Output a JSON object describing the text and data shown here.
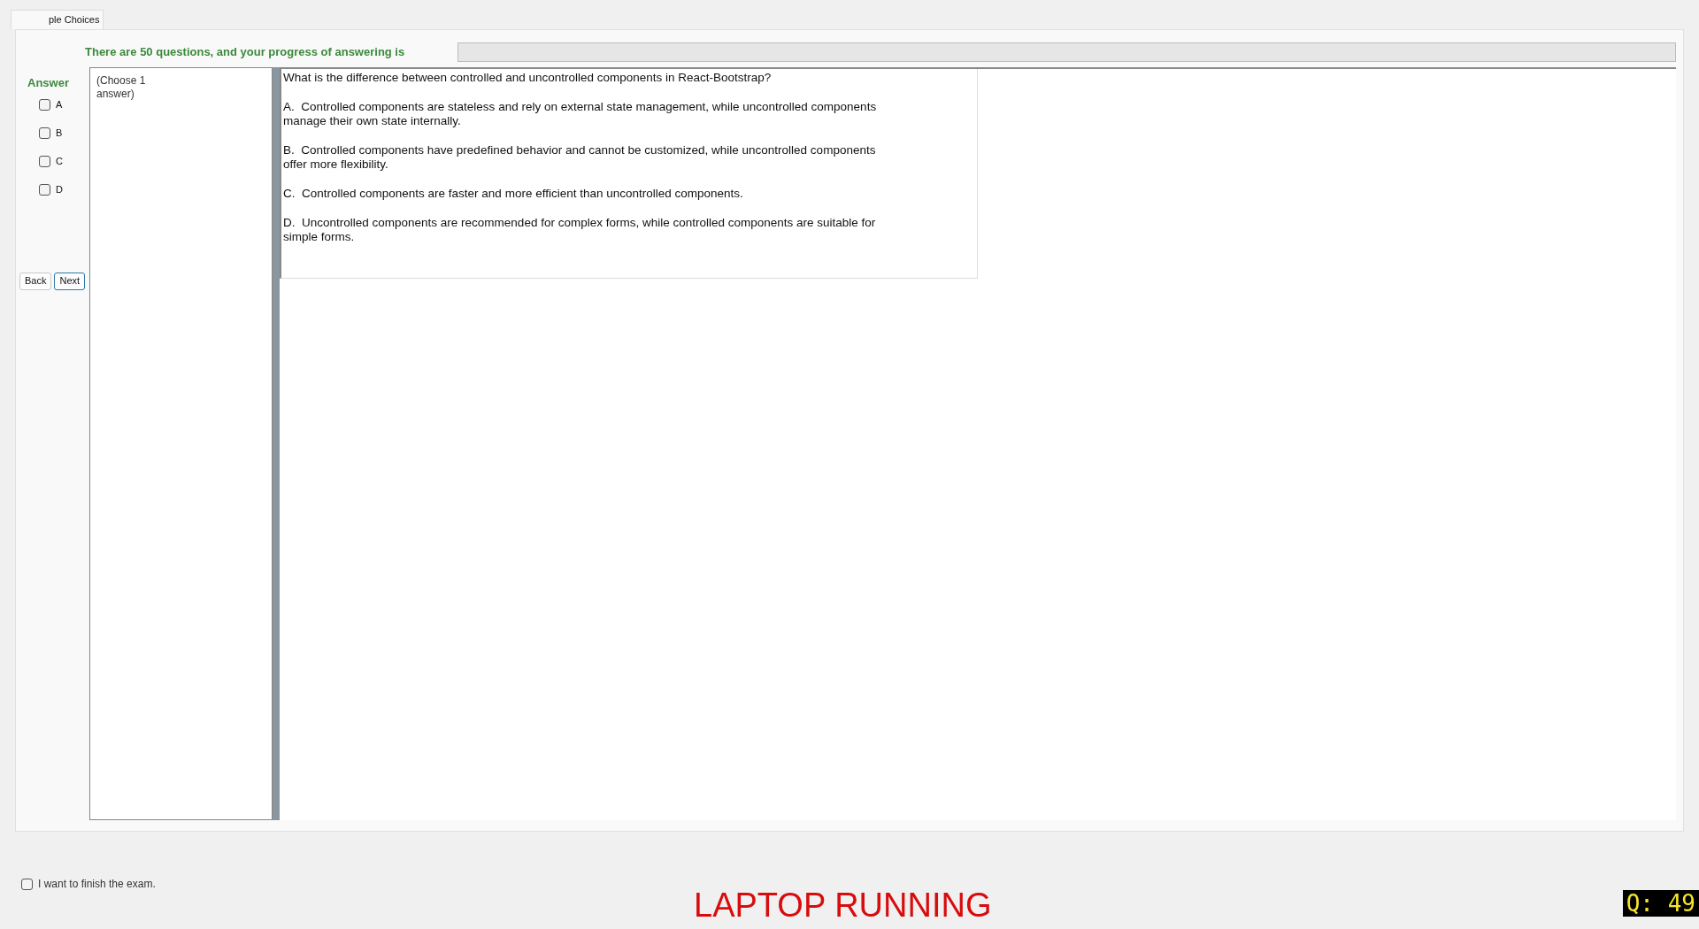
{
  "tab": {
    "label": "ple Choices"
  },
  "progress": {
    "text": "There are 50 questions, and your progress of answering is",
    "level": 0
  },
  "answer": {
    "title": "Answer",
    "options": [
      {
        "label": "A",
        "checked": false
      },
      {
        "label": "B",
        "checked": false
      },
      {
        "label": "C",
        "checked": false
      },
      {
        "label": "D",
        "checked": false
      }
    ]
  },
  "buttons": [
    {
      "label": "Back",
      "focused": false
    },
    {
      "label": "Next",
      "focused": true
    }
  ],
  "hint": "(Choose 1 answer)",
  "question": {
    "text": "What is the difference between controlled and uncontrolled components in React-Bootstrap?",
    "choices": [
      "A.  Controlled components are stateless and rely on external state management, while uncontrolled components manage their own state internally.",
      "B.  Controlled components have predefined behavior and cannot be customized, while uncontrolled components offer more flexibility.",
      "C.  Controlled components are faster and more efficient than uncontrolled components.",
      "D.  Uncontrolled components are recommended for complex forms, while controlled components are suitable for simple forms."
    ]
  },
  "finish": {
    "label": "I want to finish the exam.",
    "checked": false
  },
  "status": "LAPTOP RUNNING",
  "question_number": "Q: 49"
}
